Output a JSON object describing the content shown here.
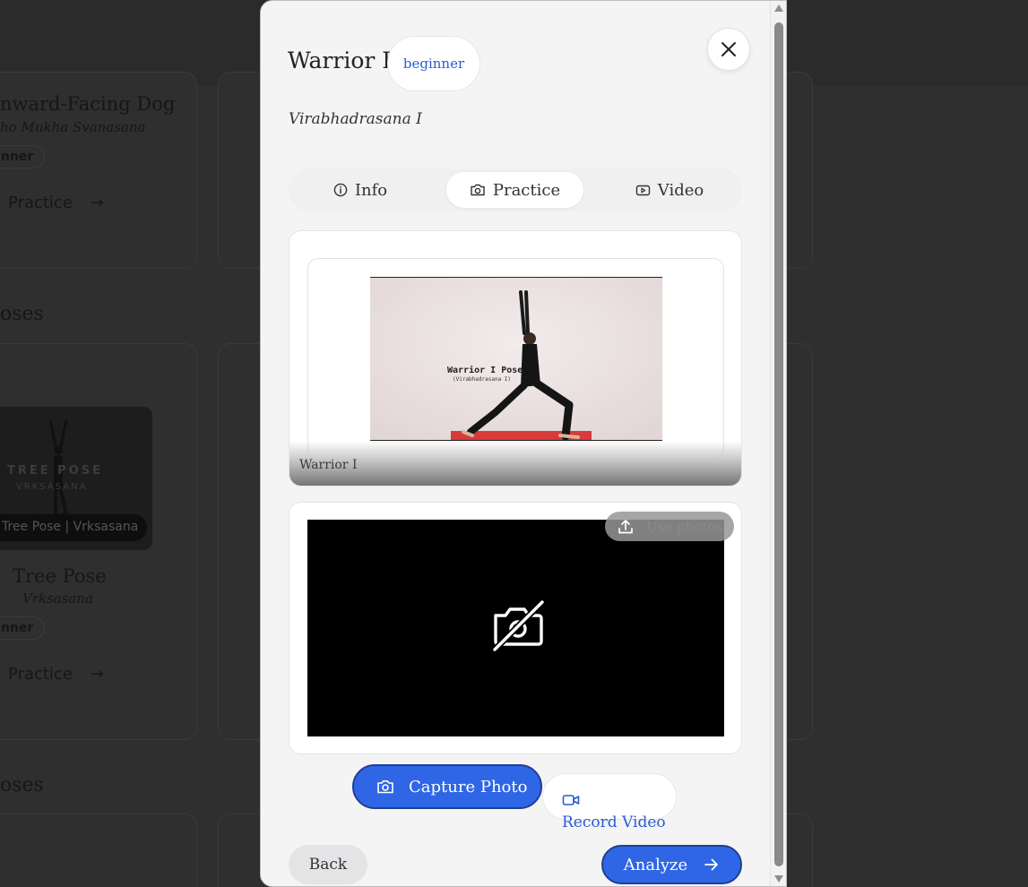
{
  "background": {
    "cards": [
      {
        "title": "nward-Facing Dog",
        "sanskrit": "ho Mukha Svanasana",
        "level": "nner",
        "practice_label": "Practice"
      },
      {
        "title": "Tree Pose",
        "sanskrit": "Vrksasana",
        "level": "nner",
        "practice_label": "Practice",
        "thumb_line1": "TREE POSE",
        "thumb_line2": "VRKSASANA",
        "thumb_caption": "Tree Pose | Vrksasana"
      }
    ],
    "sections": [
      "oses",
      "oses"
    ]
  },
  "modal": {
    "title": "Warrior I",
    "level_badge": "beginner",
    "sanskrit": "Virabhadrasana I",
    "tabs": [
      {
        "label": "Info",
        "icon": "info-icon",
        "active": false
      },
      {
        "label": "Practice",
        "icon": "camera-icon",
        "active": true
      },
      {
        "label": "Video",
        "icon": "video-play-icon",
        "active": false
      }
    ],
    "reference": {
      "caption": "Warrior I",
      "image_title": "Warrior I Pose",
      "image_subtitle": "(Virabhadrasana I)"
    },
    "camera": {
      "upload_label": "Use photos",
      "status_icon": "camera-off-icon"
    },
    "actions": {
      "capture_label": "Capture Photo",
      "record_label": "Record Video",
      "back_label": "Back",
      "analyze_label": "Analyze"
    },
    "colors": {
      "primary": "#2f66e6",
      "badge_text": "#2b5ad6"
    }
  }
}
